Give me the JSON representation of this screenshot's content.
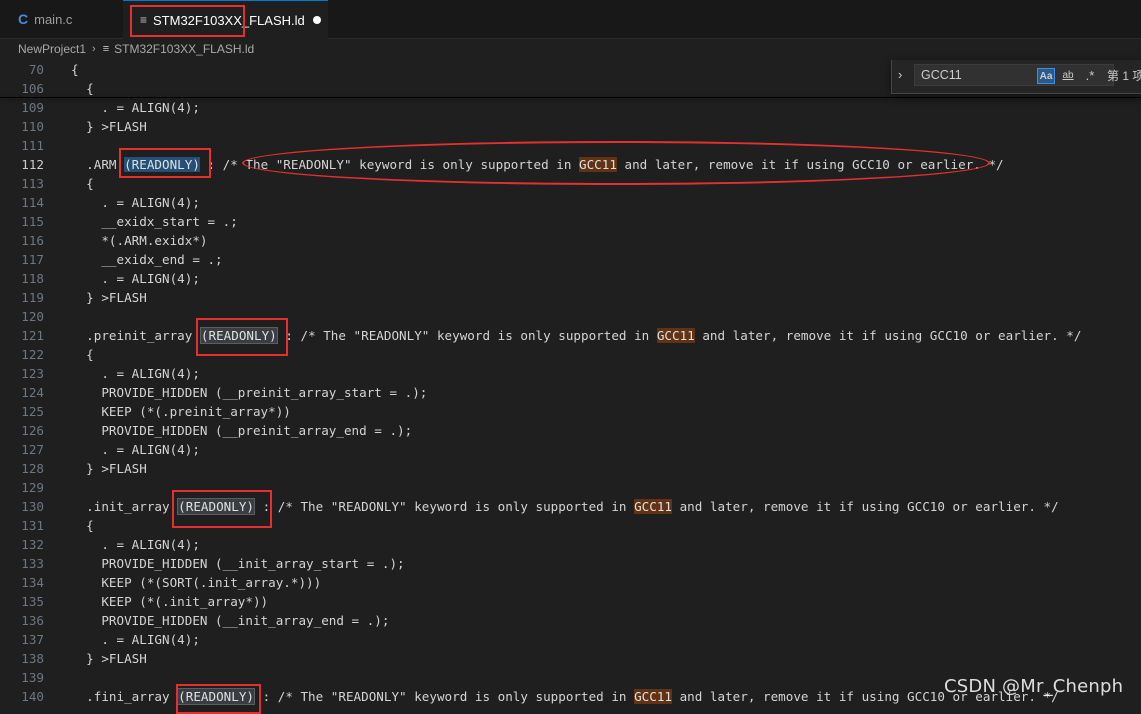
{
  "tabs": [
    {
      "icon": "C",
      "label": "main.c",
      "active": false
    },
    {
      "icon": "≡",
      "label": "STM32F103XX_FLASH.ld",
      "active": true,
      "modified": true
    }
  ],
  "breadcrumb": {
    "project": "NewProject1",
    "file": "STM32F103XX_FLASH.ld",
    "separator": "›"
  },
  "find_widget": {
    "value": "GCC11",
    "match_case": "Aa",
    "whole_word": "ab",
    "regex": ".*",
    "result": "第 1 项"
  },
  "colors": {
    "accent": "#0078d4",
    "annotation_red": "#e53030",
    "selection": "#264f78",
    "find_match": "#613214"
  },
  "sticky": [
    {
      "num": "70",
      "segs": [
        {
          "t": "{"
        }
      ]
    },
    {
      "num": "106",
      "segs": [
        {
          "t": "  {"
        }
      ]
    }
  ],
  "lines": [
    {
      "num": "109",
      "segs": [
        {
          "t": "    . = ALIGN(4);"
        }
      ]
    },
    {
      "num": "110",
      "segs": [
        {
          "t": "  } >FLASH"
        }
      ]
    },
    {
      "num": "111",
      "segs": []
    },
    {
      "num": "112",
      "current": true,
      "segs": [
        {
          "t": "  .ARM "
        },
        {
          "t": "(READONLY)",
          "c": "sel"
        },
        {
          "t": " : /* The \"READONLY\" keyword is only supported in "
        },
        {
          "t": "GCC11",
          "c": "g"
        },
        {
          "t": " and later, remove it if using GCC10 or earlier. */"
        }
      ]
    },
    {
      "num": "113",
      "segs": [
        {
          "t": "  {"
        }
      ]
    },
    {
      "num": "114",
      "segs": [
        {
          "t": "    . = ALIGN(4);"
        }
      ]
    },
    {
      "num": "115",
      "segs": [
        {
          "t": "    __exidx_start = .;"
        }
      ]
    },
    {
      "num": "116",
      "segs": [
        {
          "t": "    *(.ARM.exidx*)"
        }
      ]
    },
    {
      "num": "117",
      "segs": [
        {
          "t": "    __exidx_end = .;"
        }
      ]
    },
    {
      "num": "118",
      "segs": [
        {
          "t": "    . = ALIGN(4);"
        }
      ]
    },
    {
      "num": "119",
      "segs": [
        {
          "t": "  } >FLASH"
        }
      ]
    },
    {
      "num": "120",
      "segs": []
    },
    {
      "num": "121",
      "segs": [
        {
          "t": "  .preinit_array "
        },
        {
          "t": "(READONLY)",
          "c": "m"
        },
        {
          "t": " : /* The \"READONLY\" keyword is only supported in "
        },
        {
          "t": "GCC11",
          "c": "g"
        },
        {
          "t": " and later, remove it if using GCC10 or earlier. */"
        }
      ]
    },
    {
      "num": "122",
      "segs": [
        {
          "t": "  {"
        }
      ]
    },
    {
      "num": "123",
      "segs": [
        {
          "t": "    . = ALIGN(4);"
        }
      ]
    },
    {
      "num": "124",
      "segs": [
        {
          "t": "    PROVIDE_HIDDEN (__preinit_array_start = .);"
        }
      ]
    },
    {
      "num": "125",
      "segs": [
        {
          "t": "    KEEP (*(.preinit_array*))"
        }
      ]
    },
    {
      "num": "126",
      "segs": [
        {
          "t": "    PROVIDE_HIDDEN (__preinit_array_end = .);"
        }
      ]
    },
    {
      "num": "127",
      "segs": [
        {
          "t": "    . = ALIGN(4);"
        }
      ]
    },
    {
      "num": "128",
      "segs": [
        {
          "t": "  } >FLASH"
        }
      ]
    },
    {
      "num": "129",
      "segs": []
    },
    {
      "num": "130",
      "segs": [
        {
          "t": "  .init_array "
        },
        {
          "t": "(READONLY)",
          "c": "m"
        },
        {
          "t": " : /* The \"READONLY\" keyword is only supported in "
        },
        {
          "t": "GCC11",
          "c": "g"
        },
        {
          "t": " and later, remove it if using GCC10 or earlier. */"
        }
      ]
    },
    {
      "num": "131",
      "segs": [
        {
          "t": "  {"
        }
      ]
    },
    {
      "num": "132",
      "segs": [
        {
          "t": "    . = ALIGN(4);"
        }
      ]
    },
    {
      "num": "133",
      "segs": [
        {
          "t": "    PROVIDE_HIDDEN (__init_array_start = .);"
        }
      ]
    },
    {
      "num": "134",
      "segs": [
        {
          "t": "    KEEP (*(SORT(.init_array.*)))"
        }
      ]
    },
    {
      "num": "135",
      "segs": [
        {
          "t": "    KEEP (*(.init_array*))"
        }
      ]
    },
    {
      "num": "136",
      "segs": [
        {
          "t": "    PROVIDE_HIDDEN (__init_array_end = .);"
        }
      ]
    },
    {
      "num": "137",
      "segs": [
        {
          "t": "    . = ALIGN(4);"
        }
      ]
    },
    {
      "num": "138",
      "segs": [
        {
          "t": "  } >FLASH"
        }
      ]
    },
    {
      "num": "139",
      "segs": []
    },
    {
      "num": "140",
      "segs": [
        {
          "t": "  .fini_array "
        },
        {
          "t": "(READONLY)",
          "c": "m"
        },
        {
          "t": " : /* The \"READONLY\" keyword is only supported in "
        },
        {
          "t": "GCC11",
          "c": "g"
        },
        {
          "t": " and later, remove it if using GCC10 or earlier. */"
        }
      ]
    }
  ],
  "watermark": "CSDN @Mr_Chenph"
}
